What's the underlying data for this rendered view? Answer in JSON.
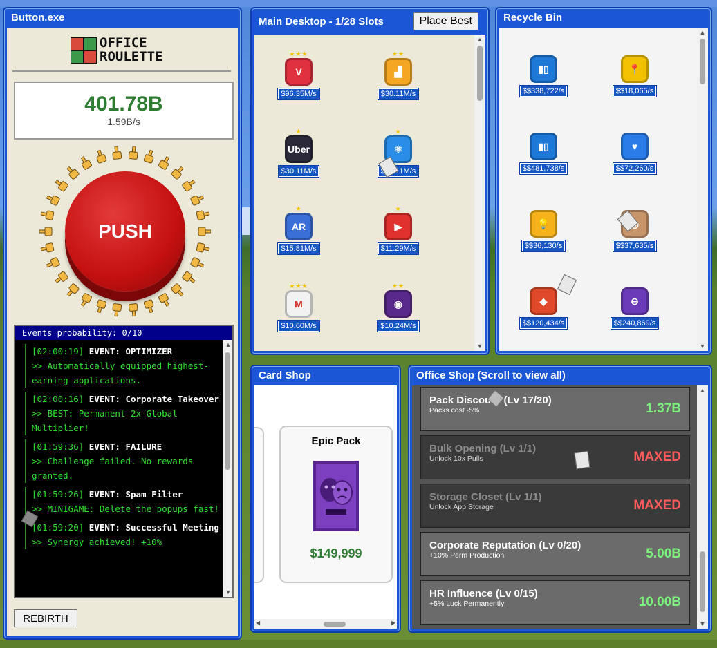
{
  "button_window": {
    "title": "Button.exe",
    "logo_line1": "OFFICE",
    "logo_line2": "ROULETTE",
    "score": "401.78B",
    "rate": "1.59B/s",
    "push_label": "PUSH",
    "events_header": "Events probability: 0/10",
    "events": [
      {
        "ts": "[02:00:19]",
        "name": "EVENT: OPTIMIZER",
        "msg": ">> Automatically equipped highest-earning applications."
      },
      {
        "ts": "[02:00:16]",
        "name": "EVENT: Corporate Takeover",
        "msg": ">> BEST: Permanent 2x Global Multiplier!"
      },
      {
        "ts": "[01:59:36]",
        "name": "EVENT: FAILURE",
        "msg": ">> Challenge failed. No rewards granted."
      },
      {
        "ts": "[01:59:26]",
        "name": "EVENT: Spam Filter",
        "msg": ">> MINIGAME: Delete the popups fast!"
      },
      {
        "ts": "[01:59:20]",
        "name": "EVENT: Successful Meeting",
        "msg": ">> Synergy achieved! +10%"
      }
    ],
    "rebirth_label": "REBIRTH"
  },
  "desktop_window": {
    "title": "Main Desktop - 1/28 Slots",
    "place_best_label": "Place Best",
    "apps": [
      {
        "icon": "vivaldi-icon",
        "stars": "★★★",
        "price": "$96.35M/s",
        "color": "#e0313f",
        "glyph": "V"
      },
      {
        "icon": "stairs-icon",
        "stars": "★★",
        "price": "$30.11M/s",
        "color": "#f5a623",
        "glyph": "▟"
      },
      {
        "icon": "uber-icon",
        "stars": "★",
        "price": "$30.11M/s",
        "color": "#2a2a3a",
        "glyph": "Uber"
      },
      {
        "icon": "atom-icon",
        "stars": "★",
        "price": "$30.11M/s",
        "color": "#2a8ee8",
        "glyph": "⚛"
      },
      {
        "icon": "ar-icon",
        "stars": "★",
        "price": "$15.81M/s",
        "color": "#3a6fd8",
        "glyph": "AR"
      },
      {
        "icon": "youtube-icon",
        "stars": "★",
        "price": "$11.29M/s",
        "color": "#e0312f",
        "glyph": "▶"
      },
      {
        "icon": "gmail-icon",
        "stars": "★★★",
        "price": "$10.60M/s",
        "color": "#f2f2f2",
        "glyph": "M"
      },
      {
        "icon": "podcast-icon",
        "stars": "★★",
        "price": "$10.24M/s",
        "color": "#5a2a8a",
        "glyph": "◉"
      }
    ]
  },
  "recycle_window": {
    "title": "Recycle Bin",
    "apps": [
      {
        "icon": "trello-icon",
        "price": "$$338,722/s",
        "color": "#1e78d8",
        "glyph": "▮▯"
      },
      {
        "icon": "map-pin-icon",
        "price": "$$18,065/s",
        "color": "#f2c200",
        "glyph": "📍"
      },
      {
        "icon": "trello-icon",
        "price": "$$481,738/s",
        "color": "#1e78d8",
        "glyph": "▮▯"
      },
      {
        "icon": "coffee-chat-icon",
        "price": "$$72,260/s",
        "color": "#2a7de8",
        "glyph": "♥"
      },
      {
        "icon": "keep-icon",
        "price": "$$36,130/s",
        "color": "#f5b21b",
        "glyph": "💡"
      },
      {
        "icon": "instagram-icon",
        "price": "$$37,635/s",
        "color": "#c7946a",
        "glyph": "◎"
      },
      {
        "icon": "diamond-home-icon",
        "price": "$$120,434/s",
        "color": "#e04a2a",
        "glyph": "◆"
      },
      {
        "icon": "tube-icon",
        "price": "$$240,869/s",
        "color": "#6a3ab8",
        "glyph": "⊖"
      }
    ]
  },
  "card_shop_window": {
    "title": "Card Shop",
    "pack_name": "Epic Pack",
    "pack_price": "$149,999"
  },
  "office_shop_window": {
    "title": "Office Shop (Scroll to view all)",
    "upgrades": [
      {
        "title": "Pack Discount (Lv 17/20)",
        "desc": "Packs cost -5%",
        "cost": "1.37B",
        "state": "avail"
      },
      {
        "title": "Bulk Opening (Lv 1/1)",
        "desc": "Unlock 10x Pulls",
        "cost": "MAXED",
        "state": "maxed"
      },
      {
        "title": "Storage Closet (Lv 1/1)",
        "desc": "Unlock App Storage",
        "cost": "MAXED",
        "state": "maxed"
      },
      {
        "title": "Corporate Reputation (Lv 0/20)",
        "desc": "+10% Perm Production",
        "cost": "5.00B",
        "state": "avail"
      },
      {
        "title": "HR Influence (Lv 0/15)",
        "desc": "+5% Luck Permanently",
        "cost": "10.00B",
        "state": "avail"
      }
    ]
  }
}
